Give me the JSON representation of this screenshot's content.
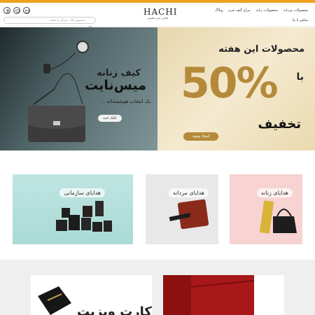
{
  "header": {
    "logo": "HACHI",
    "logo_sub": "هاچی چرم طبیعی",
    "search_placeholder": "جستجوی کالا ، ناپرگر، یا مقاله",
    "nav": [
      "محصولات مردانه",
      "محصولات زنانه",
      "مراح گیف چرم",
      "وبلاگ"
    ],
    "nav2": "تماس با ما"
  },
  "hero_left": {
    "title_1": "کیف زنانه",
    "title_2": "میس‌نایت",
    "subtitle": "یک انتخاب هوشمندانه ...",
    "button": "کلیک کنید"
  },
  "hero_right": {
    "headline": "محصولات این هفته",
    "with": "با",
    "percent": "50%",
    "off": "تخفیف",
    "button": "اینجا ببینید"
  },
  "categories": [
    {
      "label": "هدایای سازمانی"
    },
    {
      "label": "هدایای مردانه"
    },
    {
      "label": "هدایای زنانه"
    }
  ],
  "bottom": {
    "text": "کارت ویزیت"
  },
  "colors": {
    "accent": "#f0a020",
    "gold": "#b48a3a",
    "teal": "#bfe5e1",
    "pink": "#f7d3d1"
  }
}
